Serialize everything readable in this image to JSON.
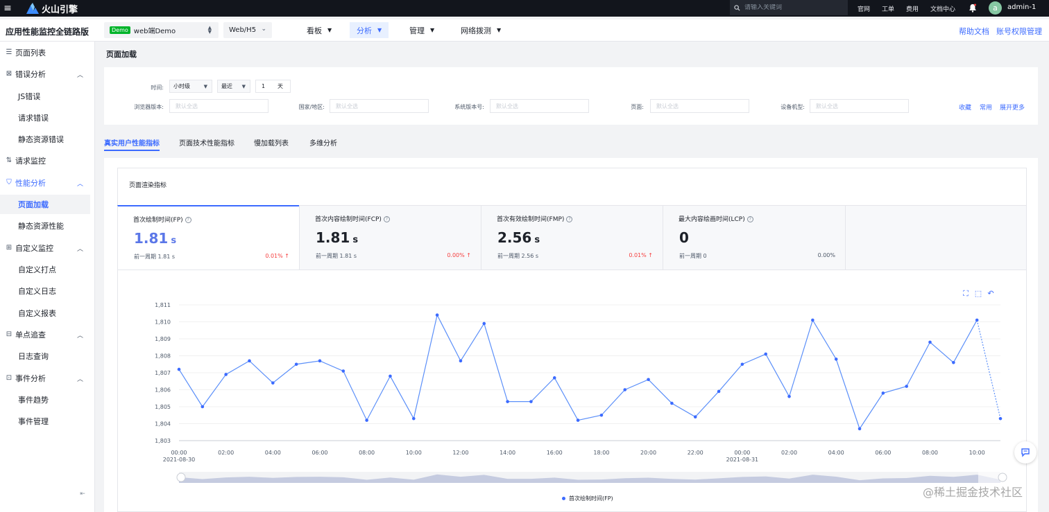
{
  "topbar": {
    "brand": "火山引擎",
    "search_placeholder": "请输入关键词",
    "links": [
      "官网",
      "工单",
      "费用",
      "文档中心"
    ],
    "avatar_letter": "a",
    "username": "admin-1"
  },
  "subheader": {
    "app_title": "应用性能监控全链路版",
    "app_badge": "Demo",
    "app_name": "web端Demo",
    "platform": "Web/H5",
    "nav": [
      "看板",
      "分析",
      "管理",
      "网络拨测"
    ],
    "active_nav": "分析",
    "help": "帮助文档",
    "account": "账号权限管理"
  },
  "sidebar": {
    "items": [
      {
        "label": "页面列表",
        "icon": "list-icon",
        "type": "top"
      },
      {
        "label": "错误分析",
        "icon": "error-icon",
        "type": "group"
      },
      {
        "label": "JS错误",
        "type": "child"
      },
      {
        "label": "请求错误",
        "type": "child"
      },
      {
        "label": "静态资源错误",
        "type": "child"
      },
      {
        "label": "请求监控",
        "icon": "request-icon",
        "type": "top"
      },
      {
        "label": "性能分析",
        "icon": "performance-icon",
        "type": "group"
      },
      {
        "label": "页面加载",
        "type": "child"
      },
      {
        "label": "静态资源性能",
        "type": "child"
      },
      {
        "label": "自定义监控",
        "icon": "custom-icon",
        "type": "group"
      },
      {
        "label": "自定义打点",
        "type": "child"
      },
      {
        "label": "自定义日志",
        "type": "child"
      },
      {
        "label": "自定义报表",
        "type": "child"
      },
      {
        "label": "单点追查",
        "icon": "trace-icon",
        "type": "group"
      },
      {
        "label": "日志查询",
        "type": "child"
      },
      {
        "label": "事件分析",
        "icon": "event-icon",
        "type": "group"
      },
      {
        "label": "事件趋势",
        "type": "child"
      },
      {
        "label": "事件管理",
        "type": "child"
      }
    ]
  },
  "page": {
    "title": "页面加载"
  },
  "filters": {
    "time_label": "时间:",
    "granularity": "小时级",
    "range": "最近",
    "count": "1",
    "unit": "天",
    "browser_label": "浏览器版本:",
    "region_label": "国家/地区:",
    "os_label": "系统版本号:",
    "page_label": "页面:",
    "device_label": "设备机型:",
    "placeholder": "默认全选",
    "favorite": "收藏",
    "common": "常用",
    "expand": "展开更多"
  },
  "tabs": [
    "真实用户性能指标",
    "页面技术性能指标",
    "慢加载列表",
    "多维分析"
  ],
  "panel": {
    "title": "页面渲染指标",
    "metrics": [
      {
        "title": "首次绘制时间(FP)",
        "value": "1.81",
        "unit": "s",
        "prev": "前一周期 1.81 s",
        "change": "0.01%",
        "trend": "up"
      },
      {
        "title": "首次内容绘制时间(FCP)",
        "value": "1.81",
        "unit": "s",
        "prev": "前一周期 1.81 s",
        "change": "0.00%",
        "trend": "up"
      },
      {
        "title": "首次有效绘制时间(FMP)",
        "value": "2.56",
        "unit": "s",
        "prev": "前一周期 2.56 s",
        "change": "0.01%",
        "trend": "up"
      },
      {
        "title": "最大内容绘画时间(LCP)",
        "value": "0",
        "unit": "",
        "prev": "前一周期 0",
        "change": "0.00%",
        "trend": "none"
      }
    ]
  },
  "chart_data": {
    "type": "line",
    "series": [
      {
        "name": "首次绘制时间(FP)",
        "values": [
          1807.2,
          1805.0,
          1806.9,
          1807.7,
          1806.4,
          1807.5,
          1807.7,
          1807.1,
          1804.2,
          1806.8,
          1804.3,
          1810.4,
          1807.7,
          1809.9,
          1805.3,
          1805.3,
          1806.7,
          1804.2,
          1804.5,
          1806.0,
          1806.6,
          1805.2,
          1804.4,
          1805.9,
          1807.5,
          1808.1,
          1805.6,
          1810.1,
          1807.8,
          1803.7,
          1805.8,
          1806.2,
          1808.8,
          1807.6,
          1810.1,
          1804.3
        ]
      }
    ],
    "x_ticks": [
      "00:00",
      "02:00",
      "04:00",
      "06:00",
      "08:00",
      "10:00",
      "12:00",
      "14:00",
      "16:00",
      "18:00",
      "20:00",
      "22:00",
      "00:00",
      "02:00",
      "04:00",
      "06:00",
      "08:00",
      "10:00"
    ],
    "date_labels": [
      "2021-08-30",
      "2021-08-31"
    ],
    "y_ticks": [
      "1,811",
      "1,810",
      "1,809",
      "1,808",
      "1,807",
      "1,806",
      "1,805",
      "1,804",
      "1,803"
    ],
    "ylim": [
      1803,
      1811
    ],
    "legend": "bottom-center",
    "color": "#5b8ff9"
  },
  "watermark": "@稀土掘金技术社区"
}
